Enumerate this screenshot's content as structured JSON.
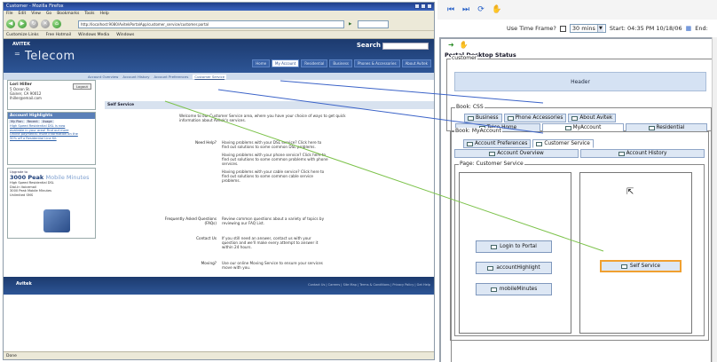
{
  "browser": {
    "title": "Customer - Mozilla Firefox",
    "menu": [
      "File",
      "Edit",
      "View",
      "Go",
      "Bookmarks",
      "Tools",
      "Help"
    ],
    "address": "http://localhost:9080/AvitekPortalApp/customer_service/customer.portal",
    "bookmarks": [
      "Customize Links",
      "Free Hotmail",
      "Windows Media",
      "Windows"
    ],
    "status": "Done"
  },
  "site": {
    "brand_small": "AVITEK",
    "brand": "Telecom",
    "search_label": "Search",
    "tabs": [
      "Home",
      "My Account",
      "Residential",
      "Business",
      "Phones & Accessories",
      "About Avitek"
    ],
    "active_tab_index": 1,
    "subnav": [
      "Account Overview",
      "Account History",
      "Account Preferences",
      "Customer Service"
    ],
    "active_subnav_index": 3,
    "login": {
      "user": "Lori Hiller",
      "logout": "Logout",
      "lines": [
        "5 Ocean St.",
        "Gainer, CA 90012",
        "lhiller@email.com"
      ]
    },
    "highlights": {
      "title": "Account Highlights",
      "tabs": [
        "My Plan",
        "Recent",
        "Usage"
      ],
      "links": [
        "High Speed Residential DSL is now",
        "available in your area! Find out more",
        "Online payments: more information on the",
        "50% off a Residential Line Kit"
      ]
    },
    "promo": {
      "small": "Upgrade to",
      "big_a": "3000 Peak",
      "big_b": "Mobile Minutes",
      "lines": [
        "High Speed Residential DSL",
        "Dial-In Voicemail",
        "3000 Peak Mobile Minutes",
        "Unlimited SMS"
      ]
    },
    "main": {
      "header": "Self Service",
      "welcome": "Welcome to our Customer Service area, where you have your choice of ways to get quick information about Avitek's services.",
      "faq_rows": [
        {
          "q": "Need Help?",
          "a1": "Having problems with your DSL service? Click here to find out solutions to some common DSL problems.",
          "a2": "Having problems with your phone service? Click here to find out solutions to some common problems with phone services.",
          "a3": "Having problems with your cable service? Click here to find out solutions to some common cable service problems."
        },
        {
          "q": "Frequently Asked Questions (FAQs)",
          "a1": "Review common questions about a variety of topics by reviewing our FAQ List."
        },
        {
          "q": "Contact Us",
          "a1": "If you still need an answer, contact us with your question and we'll make every attempt to answer it within 24 hours."
        },
        {
          "q": "Moving?",
          "a1": "Use our online Moving Service to ensure your services move with you."
        }
      ]
    },
    "footer": {
      "logo": "Avitek",
      "links": "Contact Us | Careers | Site Map | Terms & Conditions | Privacy Policy | Get Help"
    }
  },
  "desk": {
    "toolbar_icons": [
      "rewind-icon",
      "forward-icon",
      "refresh-icon",
      "hand-icon"
    ],
    "use_time_frame_label": "Use Time Frame?",
    "time_select": "30 mins",
    "start_label": "Start: 04:35 PM 10/18/06",
    "end_label": "End:",
    "title": "Portal Desktop Status",
    "customer_legend": "customer",
    "header_label": "Header",
    "book_css_legend": "Book: CSS",
    "top_tabs": [
      "Business",
      "Phone Accessories",
      "About Avitek"
    ],
    "second_tabs": [
      "Telco Home",
      "MyAccount",
      "Residential"
    ],
    "myaccount_legend": "Book: MyAccount",
    "myaccount_tabs": [
      "Account Preferences",
      "Customer Service"
    ],
    "myaccount_tabs2": [
      "Account Overview",
      "Account History"
    ],
    "page_legend": "Page: Customer Service",
    "left_portlets": [
      "Login to Portal",
      "accountHighlight",
      "mobileMinutes"
    ],
    "right_portlets": [
      "Self Service"
    ],
    "colors": {
      "highlight_border": "#f0a030",
      "connector_green": "#7cc24a",
      "connector_blue": "#3b63c8"
    }
  }
}
